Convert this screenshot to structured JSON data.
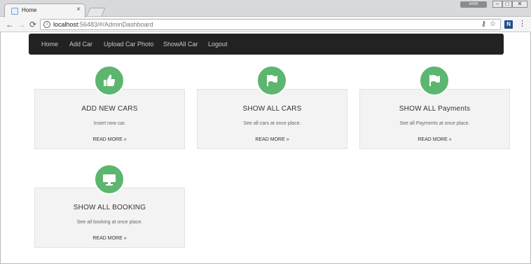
{
  "browser": {
    "tab_title": "Home",
    "tab_close": "×",
    "window_user": "vmm",
    "window_buttons": {
      "minimize": "–",
      "maximize": "□",
      "close": "✕"
    },
    "url_host": "localhost",
    "url_rest": ":56483/#/AdminDashboard",
    "extension_label": "N",
    "icons": {
      "back": "←",
      "forward": "→",
      "reload": "⟳",
      "info": "i",
      "key": "⚷",
      "star": "☆",
      "menu": "⋮"
    }
  },
  "navbar": {
    "items": [
      "Home",
      "Add Car",
      "Upload Car Photo",
      "ShowAll Car",
      "Logout"
    ]
  },
  "cards": [
    {
      "icon": "thumbs-up-icon",
      "title": "ADD NEW CARS",
      "description": "Insert new car.",
      "link": "READ MORE »"
    },
    {
      "icon": "flag-icon",
      "title": "SHOW ALL CARS",
      "description": "See all cars at once place.",
      "link": "READ MORE »"
    },
    {
      "icon": "flag-icon",
      "title": "SHOW ALL Payments",
      "description": "See all Payments at once place.",
      "link": "READ MORE »"
    },
    {
      "icon": "monitor-icon",
      "title": "SHOW ALL BOOKING",
      "description": "See all booking at once place.",
      "link": "READ MORE »"
    }
  ],
  "colors": {
    "navbar_bg": "#222222",
    "navbar_text": "#c8c8c8",
    "icon_circle": "#5cb66f",
    "card_bg": "#f3f3f3"
  }
}
